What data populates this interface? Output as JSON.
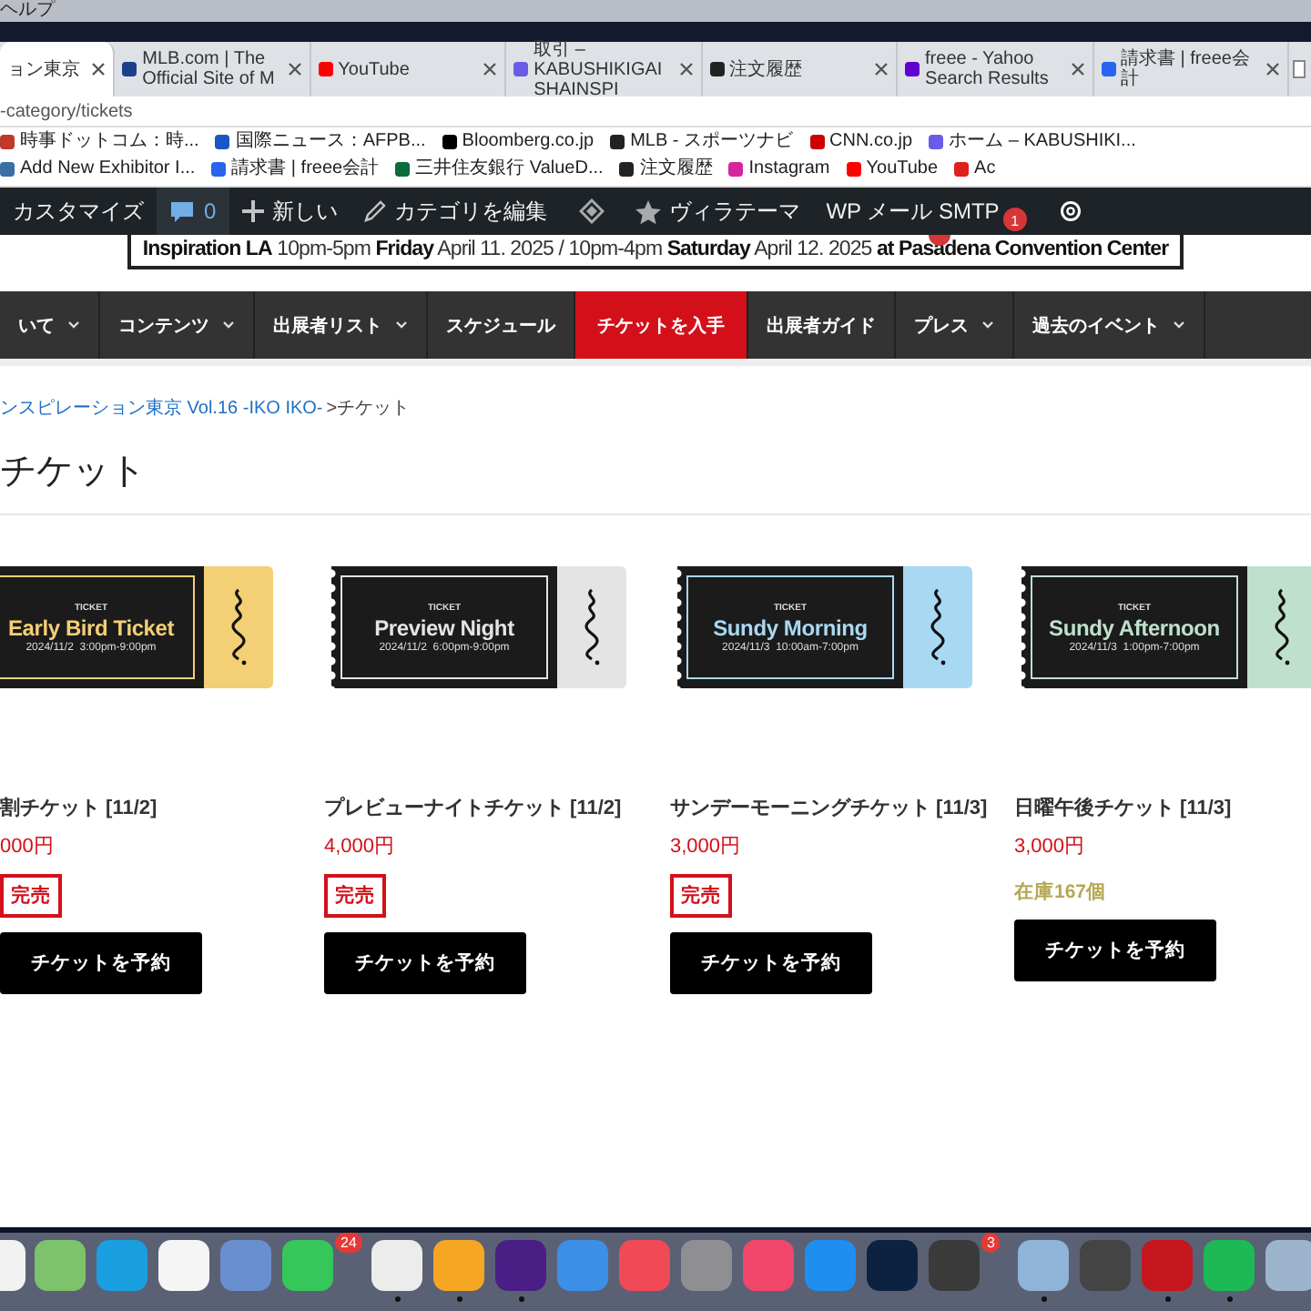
{
  "menu_bar": {
    "item": "ヘルプ"
  },
  "tabs": [
    {
      "title": "ョン東京",
      "selected": true
    },
    {
      "title": "MLB.com | The Official Site of M",
      "selected": false,
      "color": "#1d3f8a"
    },
    {
      "title": "YouTube",
      "selected": false,
      "color": "#ff0000"
    },
    {
      "title": "取引 – KABUSHIKIGAISHAINSPI",
      "selected": false,
      "color": "#6b5ce7"
    },
    {
      "title": "注文履歴",
      "selected": false,
      "color": "#222222"
    },
    {
      "title": "freee - Yahoo Search Results",
      "selected": false,
      "color": "#6001d2"
    },
    {
      "title": "請求書 | freee会計",
      "selected": false,
      "color": "#2864f0"
    }
  ],
  "address_bar": {
    "url": "-category/tickets"
  },
  "bookmarks": [
    {
      "label": "時事ドットコム：時...",
      "color": "#c0392b"
    },
    {
      "label": "国際ニュース：AFPB...",
      "color": "#1a56c4"
    },
    {
      "label": "Bloomberg.co.jp",
      "color": "#000000"
    },
    {
      "label": "MLB - スポーツナビ",
      "color": "#222222"
    },
    {
      "label": "CNN.co.jp",
      "color": "#cc0000"
    },
    {
      "label": "ホーム – KABUSHIKI...",
      "color": "#6b5ce7"
    },
    {
      "label": "Add New Exhibitor I...",
      "color": "#3a6ea5"
    },
    {
      "label": "請求書 | freee会計",
      "color": "#2864f0"
    },
    {
      "label": "三井住友銀行 ValueD...",
      "color": "#0b6b3a"
    },
    {
      "label": "注文履歴",
      "color": "#222222"
    },
    {
      "label": "Instagram",
      "color": "#d6249f"
    },
    {
      "label": "YouTube",
      "color": "#ff0000"
    },
    {
      "label": "Ac",
      "color": "#e0201b"
    }
  ],
  "admin_bar": [
    {
      "kind": "text",
      "label": "カスタマイズ",
      "selected": false
    },
    {
      "kind": "comments",
      "label": "0",
      "selected": true
    },
    {
      "kind": "new",
      "label": "新しい",
      "selected": false
    },
    {
      "kind": "edit",
      "label": "カテゴリを編集",
      "selected": false
    },
    {
      "kind": "diamond",
      "selected": false
    },
    {
      "kind": "star",
      "label": "ヴィラテーマ",
      "selected": false
    },
    {
      "kind": "smtp",
      "label": "WP メール SMTP",
      "badge": "1",
      "selected": false
    },
    {
      "kind": "gear",
      "selected": false
    }
  ],
  "banner": {
    "text": "**Inspiration LA** 10pm-5pm **Friday** April 11. 2025 / 10pm-4pm **Saturday** April 12. 2025 **at Pasadena Convention Center**"
  },
  "nav": [
    {
      "label": "いて",
      "dropdown": true,
      "selected": false
    },
    {
      "label": "コンテンツ",
      "dropdown": true,
      "selected": false
    },
    {
      "label": "出展者リスト",
      "dropdown": true,
      "selected": false
    },
    {
      "label": "スケジュール",
      "dropdown": false,
      "selected": false
    },
    {
      "label": "チケットを入手",
      "dropdown": false,
      "selected": true
    },
    {
      "label": "出展者ガイド",
      "dropdown": false,
      "selected": false
    },
    {
      "label": "プレス",
      "dropdown": true,
      "selected": false
    },
    {
      "label": "過去のイベント",
      "dropdown": true,
      "selected": false
    }
  ],
  "breadcrumb": {
    "link": "ンスピレーション東京 Vol.16 -IKO IKO-",
    "current": ">チケット"
  },
  "heading": "チケット",
  "products": [
    {
      "ticket": {
        "label": "TICKET",
        "title": "Early Bird Ticket",
        "datetime": "2024/11/2  3:00pm-9:00pm",
        "color": "#f3cf75"
      },
      "name": "割チケット [11/2]",
      "price": "000円",
      "kind": "sold_out",
      "status": "完売",
      "button": "チケットを予約"
    },
    {
      "ticket": {
        "label": "TICKET",
        "title": "Preview Night",
        "datetime": "2024/11/2  6:00pm-9:00pm",
        "color": "#e4e4e4"
      },
      "name": "プレビューナイトチケット [11/2]",
      "price": "4,000円",
      "kind": "sold_out",
      "status": "完売",
      "button": "チケットを予約"
    },
    {
      "ticket": {
        "label": "TICKET",
        "title": "Sundy Morning",
        "datetime": "2024/11/3  10:00am-7:00pm",
        "color": "#a9d8f2"
      },
      "name": "サンデーモーニングチケット [11/3]",
      "price": "3,000円",
      "kind": "sold_out",
      "status": "完売",
      "button": "チケットを予約"
    },
    {
      "ticket": {
        "label": "TICKET",
        "title": "Sundy Afternoon",
        "datetime": "2024/11/3  1:00pm-7:00pm",
        "color": "#bfe0cc"
      },
      "name": "日曜午後チケット [11/3]",
      "price": "3,000円",
      "kind": "in_stock",
      "status": "在庫167個",
      "button": "チケットを予約"
    }
  ],
  "dock": [
    {
      "color": "#f2f2f2",
      "running": false
    },
    {
      "color": "#7dc36b",
      "running": false
    },
    {
      "color": "#1a9fe0",
      "running": false
    },
    {
      "color": "#f5f5f5",
      "running": false
    },
    {
      "color": "#6a8fd0",
      "running": false
    },
    {
      "color": "#35c759",
      "running": false,
      "badge": "24"
    },
    {
      "color": "#ececec",
      "running": true
    },
    {
      "color": "#f5a623",
      "running": true
    },
    {
      "color": "#4a1f85",
      "running": true
    },
    {
      "color": "#3d8ee6",
      "running": false
    },
    {
      "color": "#f04a57",
      "running": false
    },
    {
      "color": "#8e8e93",
      "running": false
    },
    {
      "color": "#f0476a",
      "running": false
    },
    {
      "color": "#1f8ef1",
      "running": false
    },
    {
      "color": "#0b2340",
      "running": false
    },
    {
      "color": "#3a3a3a",
      "running": false,
      "badge": "3"
    },
    {
      "color": "#8fb3d9",
      "running": true
    },
    {
      "color": "#444444",
      "running": false
    },
    {
      "color": "#c5161d",
      "running": true
    },
    {
      "color": "#1db954",
      "running": true
    },
    {
      "color": "#9cb5cc",
      "running": false
    }
  ]
}
